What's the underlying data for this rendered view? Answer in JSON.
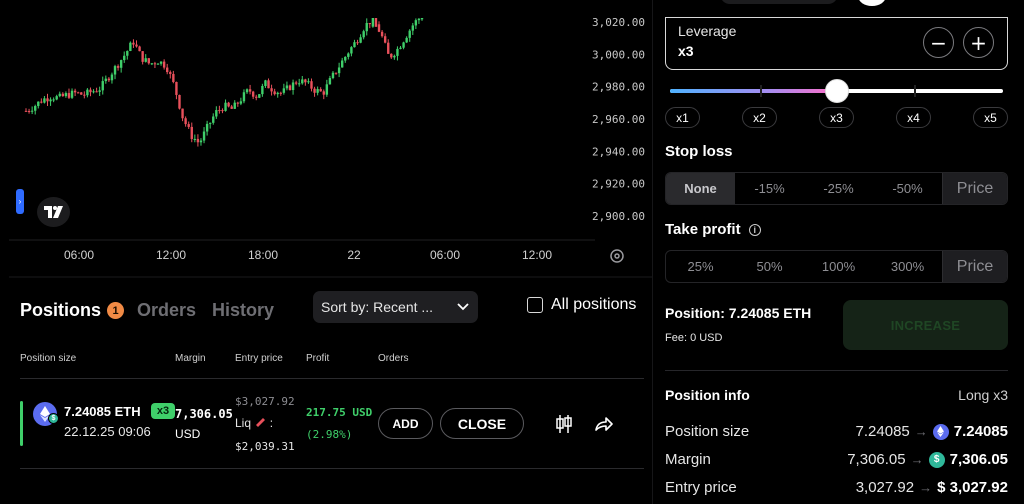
{
  "chart": {
    "y_ticks": [
      "3,020.00",
      "3,000.00",
      "2,980.00",
      "2,960.00",
      "2,940.00",
      "2,920.00",
      "2,900.00"
    ],
    "x_ticks": [
      "06:00",
      "12:00",
      "18:00",
      "22",
      "06:00",
      "12:00"
    ],
    "colors": {
      "up": "#3fcf6a",
      "down": "#e8505b"
    }
  },
  "chart_data": {
    "type": "candlestick",
    "x": [
      "06:00",
      "12:00",
      "18:00",
      "22",
      "06:00",
      "12:00"
    ],
    "ylim": [
      2890,
      3026
    ],
    "close_path": [
      2965,
      2968,
      2972,
      2974,
      2973,
      2975,
      2976,
      2975,
      2977,
      2979,
      2986,
      2993,
      3000,
      3008,
      2998,
      2994,
      2996,
      2993,
      2980,
      2961,
      2950,
      2945,
      2955,
      2964,
      2968,
      2966,
      2972,
      2978,
      2974,
      2982,
      2978,
      2976,
      2980,
      2984,
      2982,
      2978,
      2976,
      2985,
      2993,
      3001,
      3008,
      3017,
      3022,
      3013,
      2998,
      3003,
      3011,
      3019,
      3024
    ],
    "ylabel": "",
    "grid": false
  },
  "tabs": {
    "positions": "Positions",
    "positions_count": "1",
    "orders": "Orders",
    "history": "History"
  },
  "sort": {
    "label": "Sort by: Recent ..."
  },
  "all_positions": "All positions",
  "table": {
    "headers": {
      "size": "Position size",
      "margin": "Margin",
      "entry": "Entry price",
      "profit": "Profit",
      "orders": "Orders"
    },
    "rows": [
      {
        "size": "7.24085 ETH",
        "date": "22.12.25 09:06",
        "leverage": "x3",
        "margin": "7,306.05",
        "margin_currency": "USD",
        "entry": "$3,027.92",
        "liq_label": "Liq",
        "liq_sep": ":",
        "liq_price": "$2,039.31",
        "profit": "217.75 USD",
        "profit_pct": "(2.98%)",
        "add": "ADD",
        "close": "CLOSE"
      }
    ]
  },
  "panel": {
    "leverage_label": "Leverage",
    "leverage_value": "x3",
    "leverage_fraction": 0.5,
    "chips": [
      "x1",
      "x2",
      "x3",
      "x4",
      "x5"
    ],
    "stop_loss": {
      "title": "Stop loss",
      "options": [
        "None",
        "-15%",
        "-25%",
        "-50%"
      ],
      "active_index": 0,
      "price": "Price"
    },
    "take_profit": {
      "title": "Take profit",
      "info_glyph": "i",
      "options": [
        "25%",
        "50%",
        "100%",
        "300%"
      ],
      "price": "Price"
    },
    "position_title": "Position: 7.24085 ETH",
    "fee": "Fee: 0 USD",
    "increase": "INCREASE",
    "info_title": "Position info",
    "info_mode": "Long x3",
    "info_rows": [
      {
        "label": "Position size",
        "old": "7.24085",
        "new": "7.24085",
        "coin": "eth"
      },
      {
        "label": "Margin",
        "old": "7,306.05",
        "new": "7,306.05",
        "coin": "usd"
      },
      {
        "label": "Entry price",
        "old": "3,027.92",
        "new": "$ 3,027.92",
        "coin": "none"
      }
    ]
  }
}
